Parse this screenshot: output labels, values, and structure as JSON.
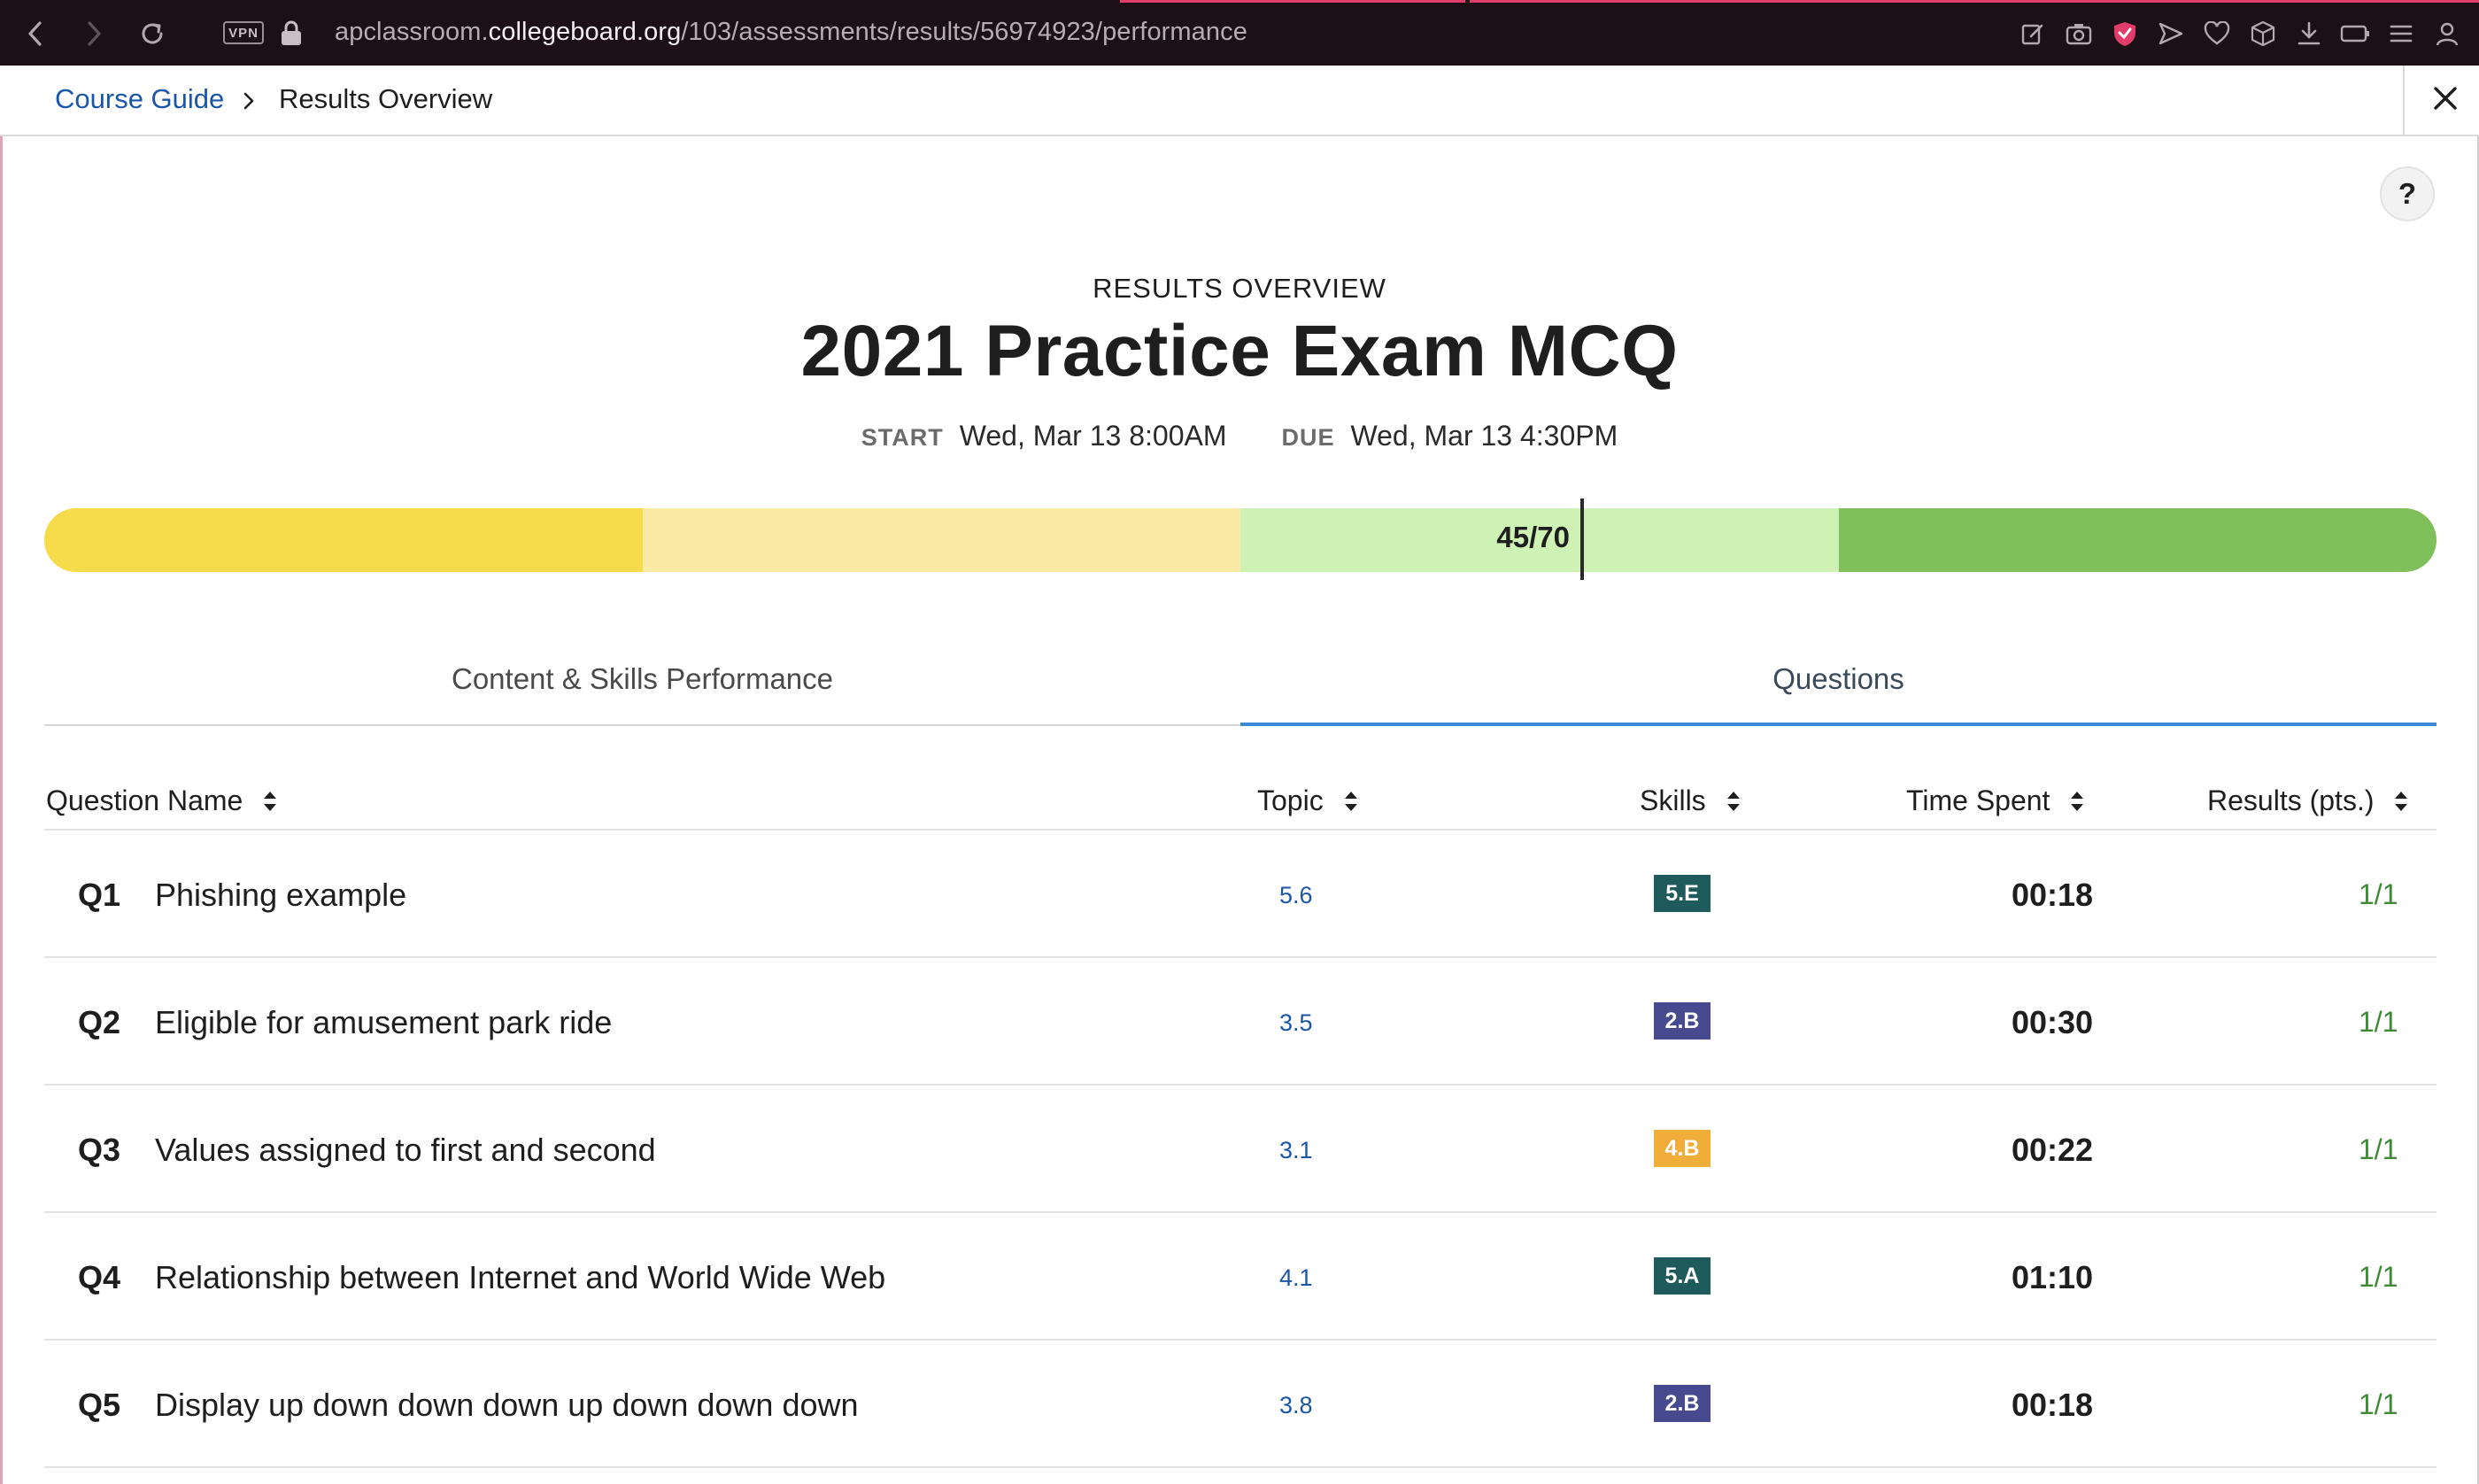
{
  "browser": {
    "vpn_label": "VPN",
    "url_prefix": "apclassroom.",
    "url_domain": "collegeboard.org",
    "url_path": "/103/assessments/results/56974923/performance"
  },
  "breadcrumb": {
    "link": "Course Guide",
    "current": "Results Overview"
  },
  "help_label": "?",
  "header": {
    "eyebrow": "RESULTS OVERVIEW",
    "title": "2021 Practice Exam MCQ",
    "start_label": "START",
    "start_value": "Wed, Mar 13 8:00AM",
    "due_label": "DUE",
    "due_value": "Wed, Mar 13 4:30PM"
  },
  "score": {
    "label": "45/70",
    "earned": 45,
    "total": 70,
    "bands": [
      {
        "name": "band-1",
        "color": "#f6db4a"
      },
      {
        "name": "band-2",
        "color": "#fbeaa6"
      },
      {
        "name": "band-3",
        "color": "#cdf2b4"
      },
      {
        "name": "band-4",
        "color": "#80c05a"
      }
    ]
  },
  "tabs": [
    {
      "label": "Content & Skills Performance",
      "active": false
    },
    {
      "label": "Questions",
      "active": true
    }
  ],
  "table": {
    "headers": {
      "question_name": "Question Name",
      "topic": "Topic",
      "skills": "Skills",
      "time_spent": "Time Spent",
      "results": "Results (pts.)"
    },
    "rows": [
      {
        "id": "Q1",
        "name": "Phishing example",
        "topic": "5.6",
        "skill": "5.E",
        "skill_color": "#1f5a5c",
        "time": "00:18",
        "result": "1/1"
      },
      {
        "id": "Q2",
        "name": "Eligible for amusement park ride",
        "topic": "3.5",
        "skill": "2.B",
        "skill_color": "#474a8f",
        "time": "00:30",
        "result": "1/1"
      },
      {
        "id": "Q3",
        "name": "Values assigned to first and second",
        "topic": "3.1",
        "skill": "4.B",
        "skill_color": "#f0ad3a",
        "time": "00:22",
        "result": "1/1"
      },
      {
        "id": "Q4",
        "name": "Relationship between Internet and World Wide Web",
        "topic": "4.1",
        "skill": "5.A",
        "skill_color": "#1f5a5c",
        "time": "01:10",
        "result": "1/1"
      },
      {
        "id": "Q5",
        "name": "Display up down down down up down down down",
        "topic": "3.8",
        "skill": "2.B",
        "skill_color": "#474a8f",
        "time": "00:18",
        "result": "1/1"
      }
    ]
  }
}
